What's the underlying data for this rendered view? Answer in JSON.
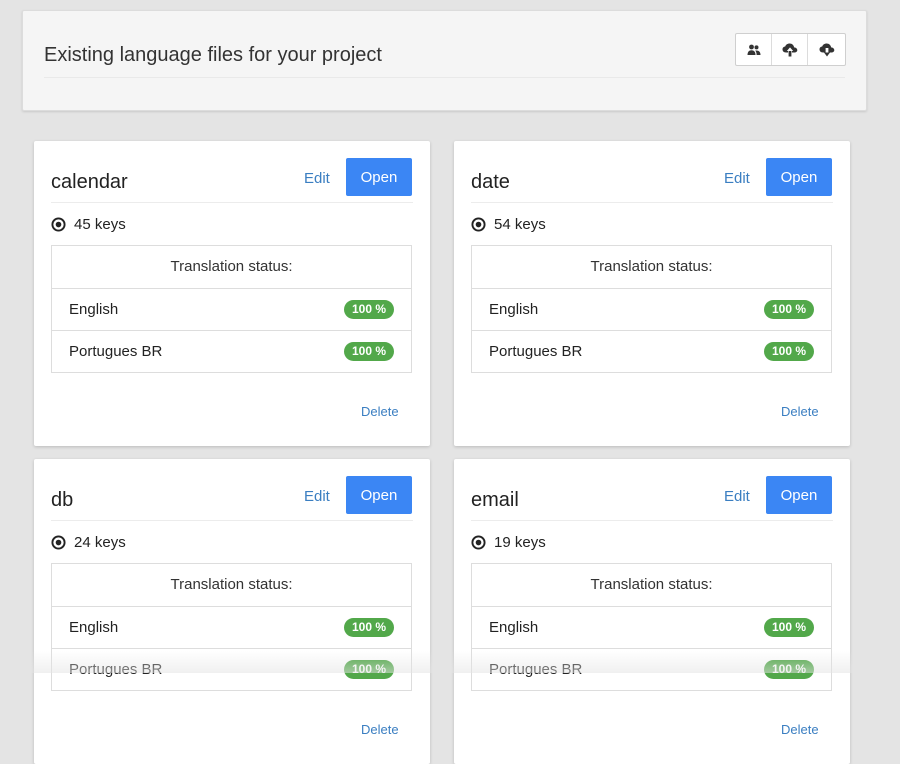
{
  "header": {
    "title": "Existing language files for your project",
    "icons": [
      "users-icon",
      "cloud-upload-icon",
      "cloud-download-icon"
    ]
  },
  "colors": {
    "primary": "#3b86f4",
    "link": "#3a7ec1",
    "success": "#52a84a",
    "background": "#e4e4e4"
  },
  "cards": [
    {
      "name": "calendar",
      "edit_label": "Edit",
      "open_label": "Open",
      "keys": "45 keys",
      "status_header": "Translation status:",
      "languages": [
        {
          "name": "English",
          "percent": "100 %"
        },
        {
          "name": "Portugues BR",
          "percent": "100 %"
        }
      ],
      "delete_label": "Delete"
    },
    {
      "name": "date",
      "edit_label": "Edit",
      "open_label": "Open",
      "keys": "54 keys",
      "status_header": "Translation status:",
      "languages": [
        {
          "name": "English",
          "percent": "100 %"
        },
        {
          "name": "Portugues BR",
          "percent": "100 %"
        }
      ],
      "delete_label": "Delete"
    },
    {
      "name": "db",
      "edit_label": "Edit",
      "open_label": "Open",
      "keys": "24 keys",
      "status_header": "Translation status:",
      "languages": [
        {
          "name": "English",
          "percent": "100 %"
        },
        {
          "name": "Portugues BR",
          "percent": "100 %"
        }
      ],
      "delete_label": "Delete"
    },
    {
      "name": "email",
      "edit_label": "Edit",
      "open_label": "Open",
      "keys": "19 keys",
      "status_header": "Translation status:",
      "languages": [
        {
          "name": "English",
          "percent": "100 %"
        },
        {
          "name": "Portugues BR",
          "percent": "100 %"
        }
      ],
      "delete_label": "Delete"
    }
  ]
}
